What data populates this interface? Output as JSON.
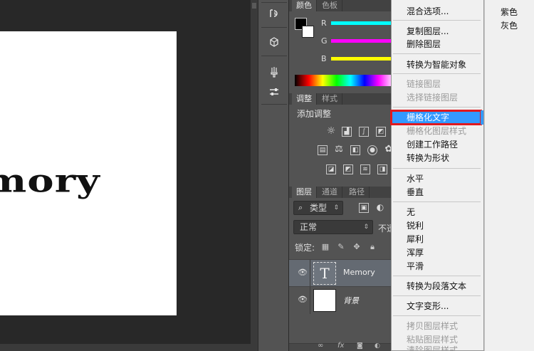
{
  "document": {
    "visible_text": "mory"
  },
  "color_panel": {
    "tabs": [
      "颜色",
      "色板"
    ],
    "sliders": [
      {
        "label": "R",
        "color": "#00ffff"
      },
      {
        "label": "G",
        "color": "#ff00ff"
      },
      {
        "label": "B",
        "color": "#ffff00"
      }
    ]
  },
  "adjustments_panel": {
    "tabs": [
      "调整",
      "样式"
    ],
    "title": "添加调整"
  },
  "layers_panel": {
    "tabs": [
      "图层",
      "通道",
      "路径"
    ],
    "filter_kind": "类型",
    "blend_mode": "正常",
    "opacity_label": "不透",
    "lock_label": "锁定:",
    "layers": [
      {
        "name": "Memory",
        "type": "text",
        "thumb_glyph": "T",
        "selected": true
      },
      {
        "name": "背景",
        "type": "background",
        "selected": false
      }
    ]
  },
  "context_menu": {
    "items": [
      {
        "label": "混合选项...",
        "enabled": true
      },
      {
        "label": "复制图层...",
        "enabled": true
      },
      {
        "label": "删除图层",
        "enabled": true
      },
      {
        "label": "转换为智能对象",
        "enabled": true
      },
      {
        "label": "链接图层",
        "enabled": false
      },
      {
        "label": "选择链接图层",
        "enabled": false
      },
      {
        "label": "栅格化文字",
        "enabled": true,
        "highlighted": true
      },
      {
        "label": "栅格化图层样式",
        "enabled": false
      },
      {
        "label": "创建工作路径",
        "enabled": true
      },
      {
        "label": "转换为形状",
        "enabled": true
      },
      {
        "label": "水平",
        "enabled": true
      },
      {
        "label": "垂直",
        "enabled": true
      },
      {
        "label": "无",
        "enabled": true
      },
      {
        "label": "锐利",
        "enabled": true
      },
      {
        "label": "犀利",
        "enabled": true
      },
      {
        "label": "浑厚",
        "enabled": true
      },
      {
        "label": "平滑",
        "enabled": true
      },
      {
        "label": "转换为段落文本",
        "enabled": true
      },
      {
        "label": "文字变形...",
        "enabled": true
      },
      {
        "label": "拷贝图层样式",
        "enabled": false
      },
      {
        "label": "粘贴图层样式",
        "enabled": false
      },
      {
        "label": "清除图层样式",
        "enabled": false
      }
    ],
    "highlight_color": "#3399ff",
    "annotation_color": "#e0191e"
  },
  "submenu": {
    "items": [
      "紫色",
      "灰色"
    ]
  }
}
